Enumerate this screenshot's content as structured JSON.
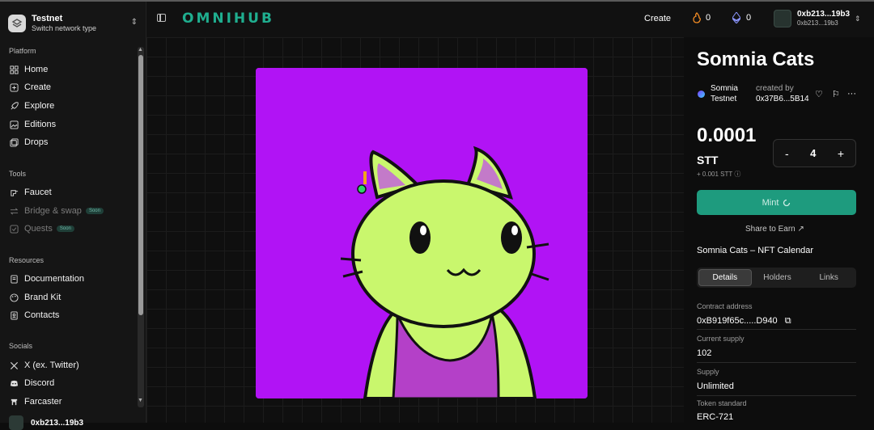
{
  "network": {
    "title": "Testnet",
    "subtitle": "Switch network type"
  },
  "sidebar": {
    "platform_title": "Platform",
    "platform": [
      {
        "label": "Home",
        "icon": "grid-icon"
      },
      {
        "label": "Create",
        "icon": "plus-square-icon"
      },
      {
        "label": "Explore",
        "icon": "rocket-icon"
      },
      {
        "label": "Editions",
        "icon": "image-icon"
      },
      {
        "label": "Drops",
        "icon": "images-icon"
      }
    ],
    "tools_title": "Tools",
    "tools": [
      {
        "label": "Faucet",
        "icon": "faucet-icon"
      },
      {
        "label": "Bridge & swap",
        "icon": "swap-icon",
        "badge": "Soon"
      },
      {
        "label": "Quests",
        "icon": "check-square-icon",
        "badge": "Soon"
      }
    ],
    "resources_title": "Resources",
    "resources": [
      {
        "label": "Documentation",
        "icon": "book-icon"
      },
      {
        "label": "Brand Kit",
        "icon": "palette-icon"
      },
      {
        "label": "Contacts",
        "icon": "contacts-icon"
      }
    ],
    "socials_title": "Socials",
    "socials": [
      {
        "label": "X (ex. Twitter)",
        "icon": "x-icon"
      },
      {
        "label": "Discord",
        "icon": "discord-icon"
      },
      {
        "label": "Farcaster",
        "icon": "farcaster-icon"
      }
    ],
    "user": "0xb213...19b3"
  },
  "header": {
    "brand": "OMNIHUB",
    "create": "Create",
    "fire_count": "0",
    "eth_count": "0",
    "user_short": "0xb213...19b3",
    "user_sub": "0xb213...19b3"
  },
  "item": {
    "title": "Somnia Cats",
    "chain_line1": "Somnia",
    "chain_line2": "Testnet",
    "created_by_label": "created by",
    "creator": "0x37B6...5B14",
    "price": "0.0001",
    "currency": "STT",
    "fee": "+ 0.001 STT",
    "quantity": "4",
    "minus": "-",
    "plus": "+",
    "mint_label": "Mint",
    "share_label": "Share to Earn",
    "collection": "Somnia Cats – NFT Calendar",
    "tabs": [
      "Details",
      "Holders",
      "Links"
    ],
    "details": [
      {
        "label": "Contract address",
        "value": "0xB919f65c.....D940"
      },
      {
        "label": "Current supply",
        "value": "102"
      },
      {
        "label": "Supply",
        "value": "Unlimited"
      },
      {
        "label": "Token standard",
        "value": "ERC-721"
      }
    ]
  },
  "colors": {
    "accent": "#1fae8f",
    "mint_bg": "#1e9b7e",
    "nft_bg": "#b113f5",
    "cat_body": "#c9f76d"
  }
}
